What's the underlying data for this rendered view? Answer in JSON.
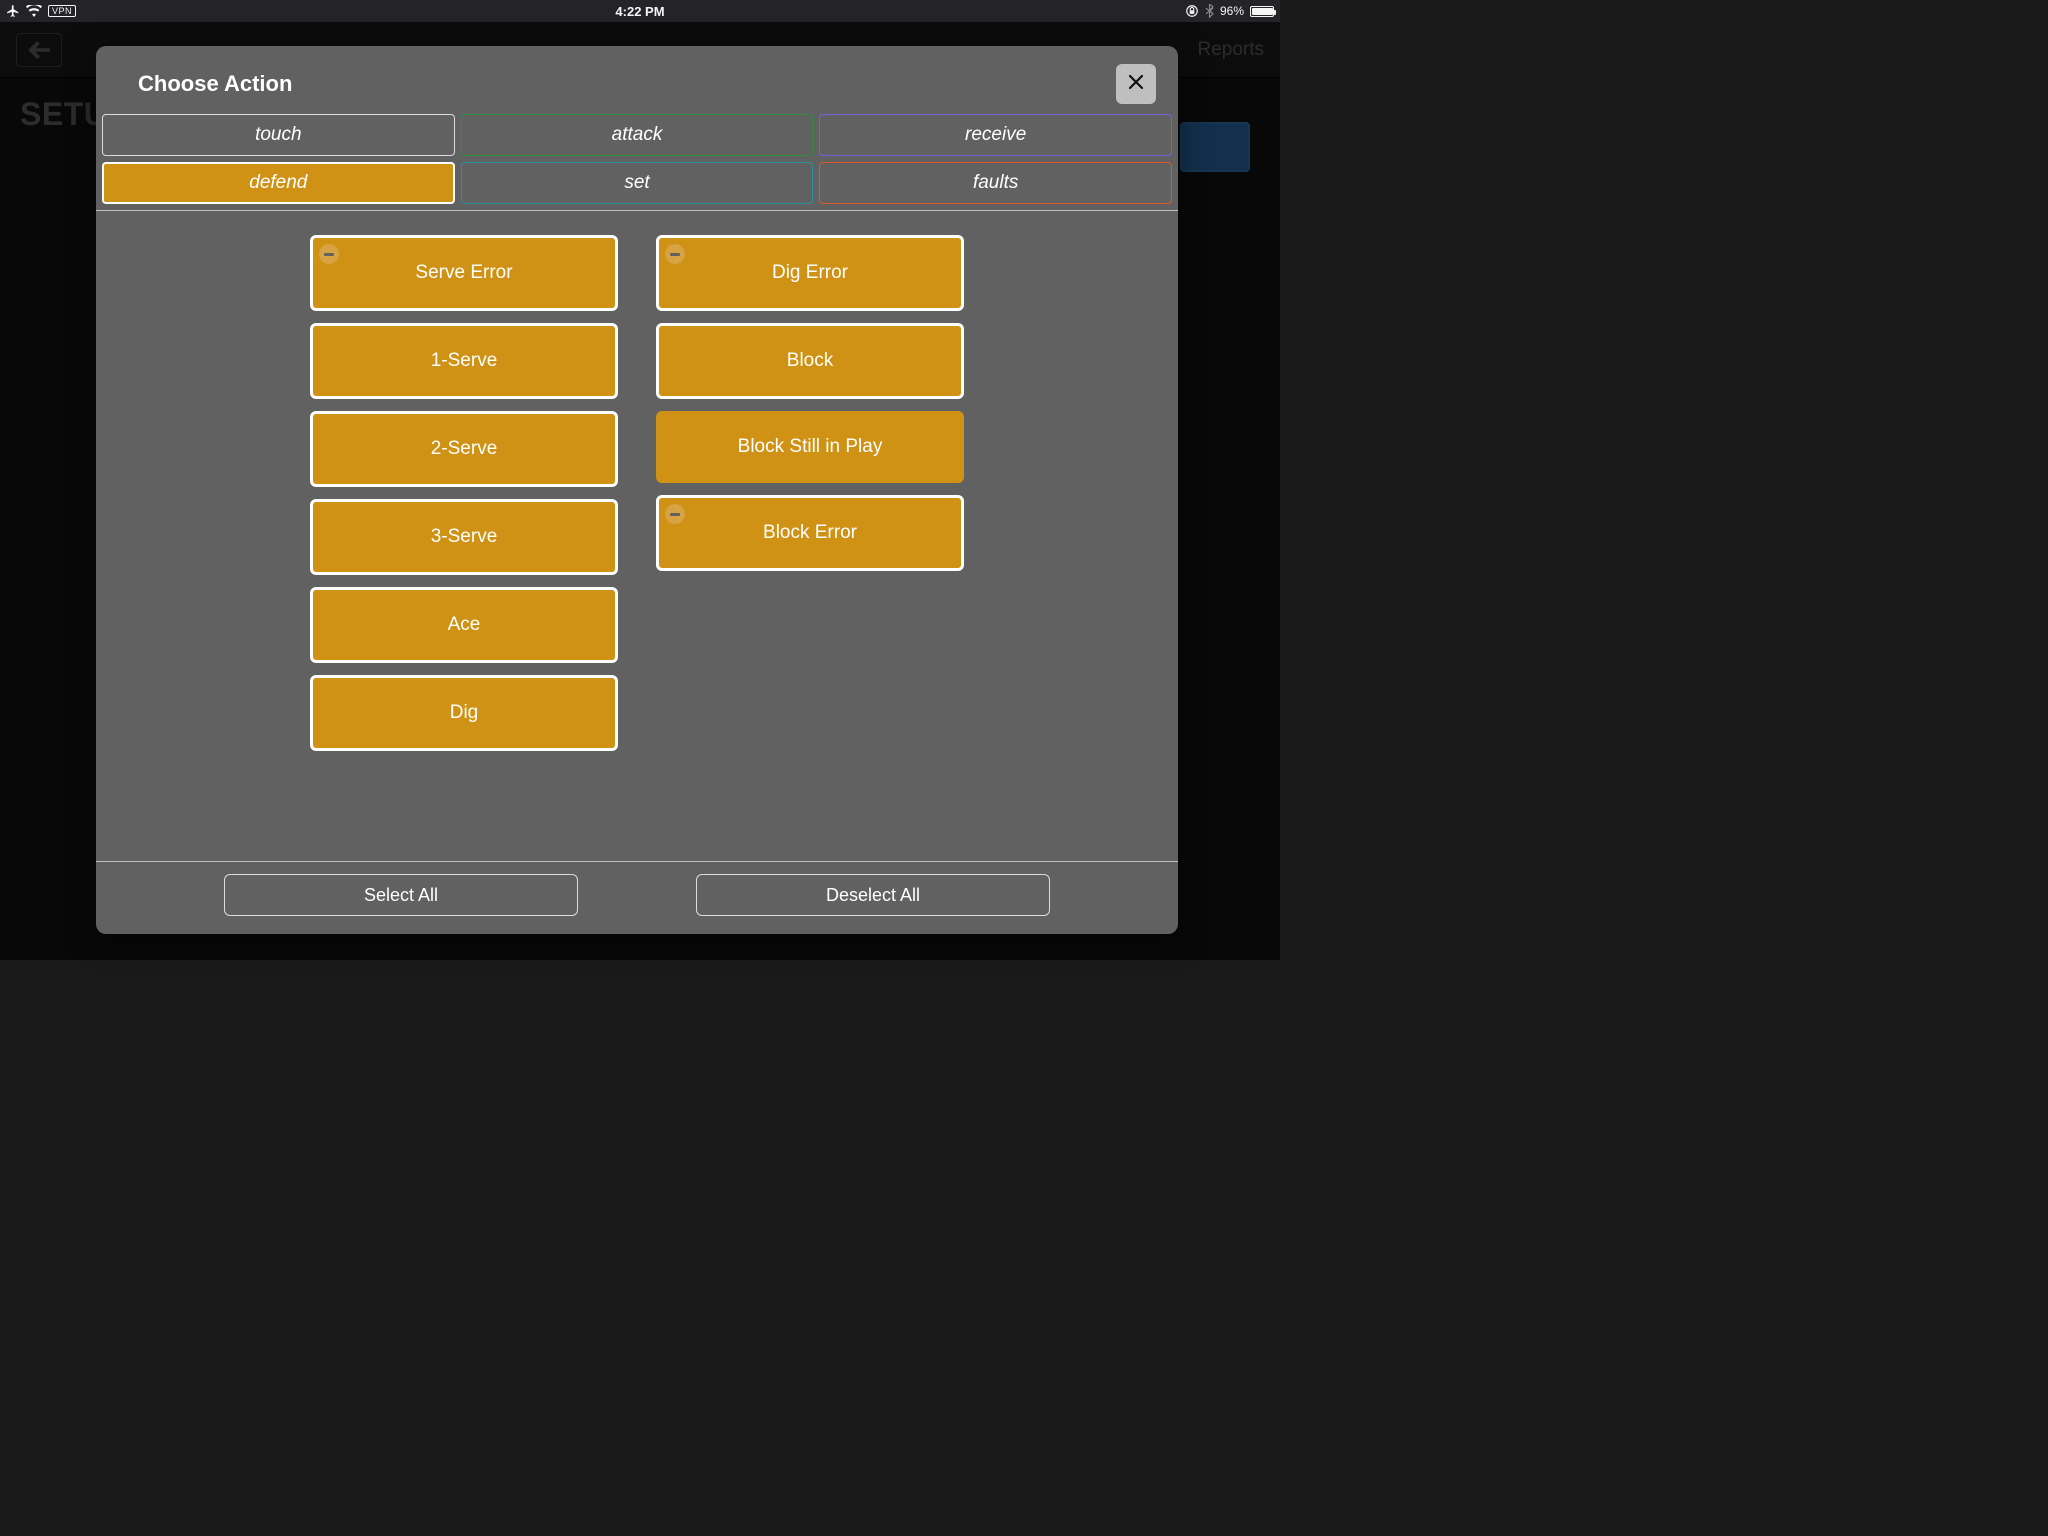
{
  "status": {
    "time": "4:22 PM",
    "vpn_label": "VPN",
    "battery_text": "96%",
    "battery_fill_pct": 96
  },
  "background": {
    "title": "SETUP",
    "reports_label": "Reports"
  },
  "modal": {
    "title": "Choose Action",
    "categories": {
      "touch": "touch",
      "attack": "attack",
      "receive": "receive",
      "defend": "defend",
      "set": "set",
      "faults": "faults"
    },
    "actions_col1": [
      {
        "label": "Serve Error",
        "selected": true,
        "minus": true
      },
      {
        "label": "1-Serve",
        "selected": true,
        "minus": false
      },
      {
        "label": "2-Serve",
        "selected": true,
        "minus": false
      },
      {
        "label": "3-Serve",
        "selected": true,
        "minus": false
      },
      {
        "label": "Ace",
        "selected": true,
        "minus": false
      },
      {
        "label": "Dig",
        "selected": true,
        "minus": false
      }
    ],
    "actions_col2": [
      {
        "label": "Dig Error",
        "selected": true,
        "minus": true
      },
      {
        "label": "Block",
        "selected": true,
        "minus": false
      },
      {
        "label": "Block Still in Play",
        "selected": false,
        "minus": false
      },
      {
        "label": "Block Error",
        "selected": true,
        "minus": true
      }
    ],
    "footer": {
      "select_all": "Select All",
      "deselect_all": "Deselect All"
    }
  }
}
